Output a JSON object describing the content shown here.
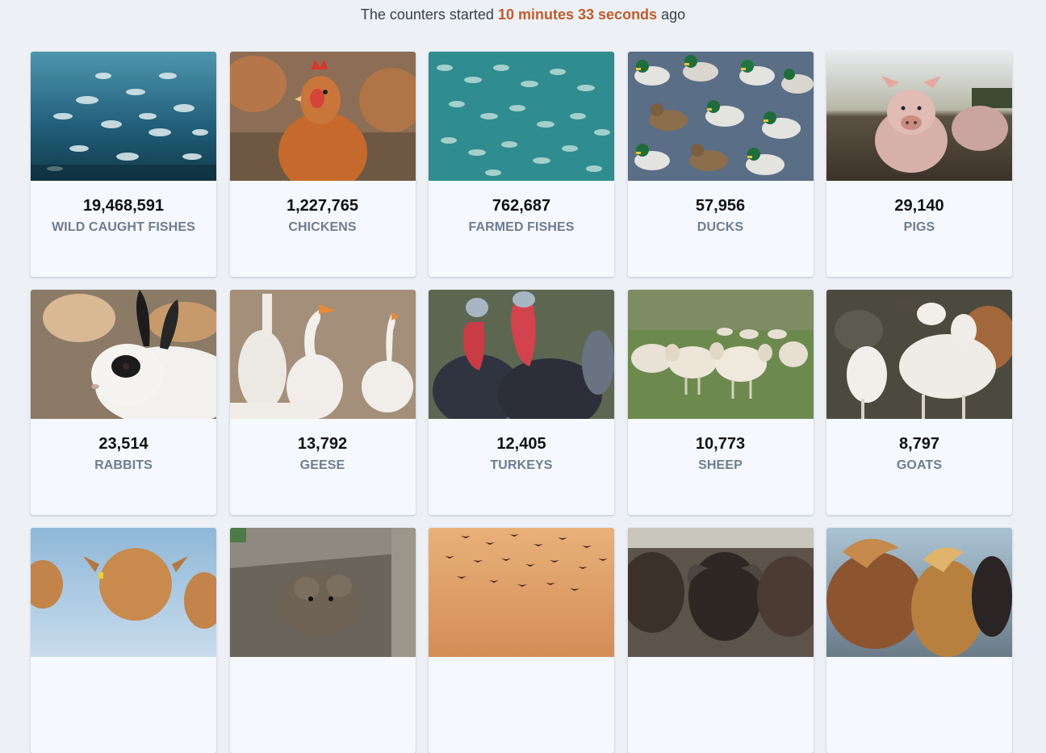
{
  "header": {
    "prefix": "The counters started",
    "minutes": "10 minutes",
    "seconds": "33 seconds",
    "suffix": "ago"
  },
  "colors": {
    "accent": "#c35a2a",
    "background": "#edf1f6",
    "card": "#f5f8fc",
    "label": "#6f7c90"
  },
  "cards": [
    {
      "count": "19,468,591",
      "label": "WILD CAUGHT FISHES"
    },
    {
      "count": "1,227,765",
      "label": "CHICKENS"
    },
    {
      "count": "762,687",
      "label": "FARMED FISHES"
    },
    {
      "count": "57,956",
      "label": "DUCKS"
    },
    {
      "count": "29,140",
      "label": "PIGS"
    },
    {
      "count": "23,514",
      "label": "RABBITS"
    },
    {
      "count": "13,792",
      "label": "GEESE"
    },
    {
      "count": "12,405",
      "label": "TURKEYS"
    },
    {
      "count": "10,773",
      "label": "SHEEP"
    },
    {
      "count": "8,797",
      "label": "GOATS"
    },
    {
      "count": "",
      "label": ""
    },
    {
      "count": "",
      "label": ""
    },
    {
      "count": "",
      "label": ""
    },
    {
      "count": "",
      "label": ""
    },
    {
      "count": "",
      "label": ""
    }
  ]
}
